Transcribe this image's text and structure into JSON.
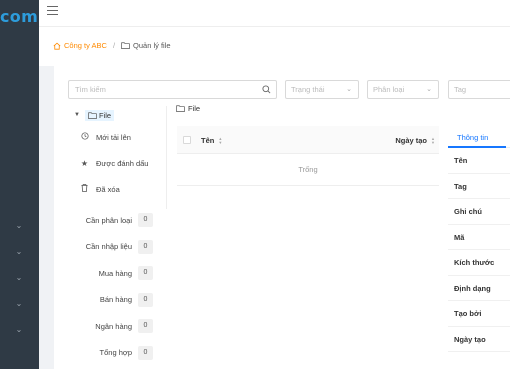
{
  "app": {
    "logo_text": "com"
  },
  "breadcrumb": {
    "home": "Công ty ABC",
    "separator": "/",
    "current": "Quản lý file"
  },
  "filters": {
    "search_placeholder": "Tìm kiếm",
    "status_placeholder": "Trạng thái",
    "category_placeholder": "Phân loại",
    "tag_placeholder": "Tag"
  },
  "tree": {
    "root": "File",
    "items": [
      {
        "label": "Mới tải lên",
        "icon": "clock-icon"
      },
      {
        "label": "Được đánh dấu",
        "icon": "star-icon"
      },
      {
        "label": "Đã xóa",
        "icon": "trash-icon"
      }
    ]
  },
  "categories": [
    {
      "label": "Cần phân loại",
      "count": "0"
    },
    {
      "label": "Cần nhập liệu",
      "count": "0"
    },
    {
      "label": "Mua hàng",
      "count": "0"
    },
    {
      "label": "Bán hàng",
      "count": "0"
    },
    {
      "label": "Ngân hàng",
      "count": "0"
    },
    {
      "label": "Tổng hợp",
      "count": "0"
    }
  ],
  "main": {
    "folder_title": "File",
    "columns": {
      "name": "Tên",
      "created": "Ngày tạo"
    },
    "empty_text": "Trống"
  },
  "info": {
    "tab": "Thông tin",
    "fields": [
      "Tên",
      "Tag",
      "Ghi chú",
      "Mã",
      "Kích thước",
      "Định dạng",
      "Tạo bởi",
      "Ngày tạo"
    ]
  },
  "colors": {
    "accent": "#1677ff",
    "home": "#ff8a00",
    "sidebar": "#2f3a45",
    "logo": "#2d9cdb"
  }
}
